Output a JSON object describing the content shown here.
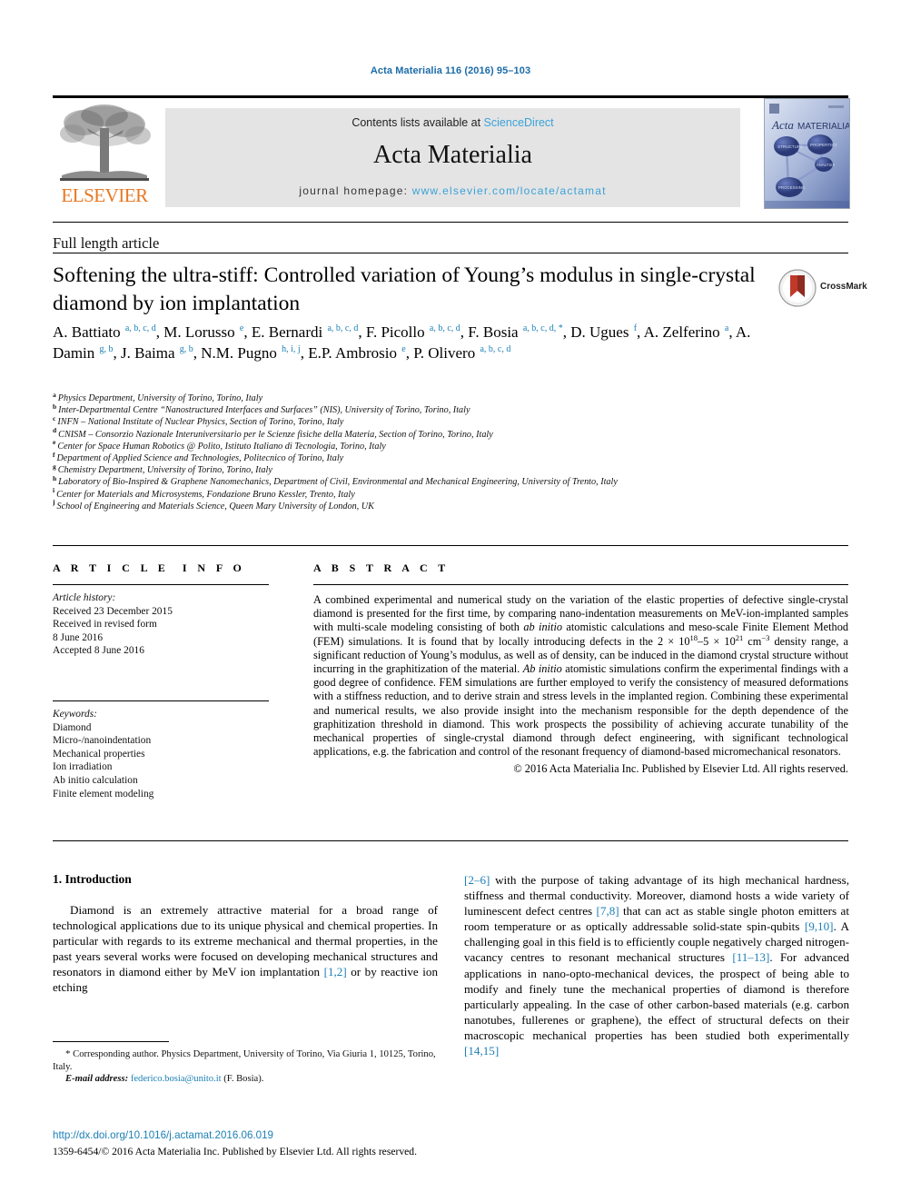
{
  "running_head": "Acta Materialia 116 (2016) 95–103",
  "banner": {
    "publisher_name": "ELSEVIER",
    "contents_prefix": "Contents lists available at ",
    "contents_link": "ScienceDirect",
    "journal_title": "Acta Materialia",
    "homepage_prefix": "journal homepage: ",
    "homepage_url": "www.elsevier.com/locate/actamat",
    "cover_title_italic": "Acta",
    "cover_title_rest": "MATERIALIA",
    "cover_nodes": [
      "STRUCTURE",
      "PROPERTIES",
      "ANALYSIS",
      "PROCESSING"
    ]
  },
  "article": {
    "type": "Full length article",
    "title": "Softening the ultra-stiff: Controlled variation of Young’s modulus in single-crystal diamond by ion implantation",
    "crossmark_label": "CrossMark"
  },
  "authors": [
    {
      "name": "A. Battiato",
      "marks": "a, b, c, d",
      "sep": ", "
    },
    {
      "name": "M. Lorusso",
      "marks": "e",
      "sep": ", "
    },
    {
      "name": "E. Bernardi",
      "marks": "a, b, c, d",
      "sep": ", "
    },
    {
      "name": "F. Picollo",
      "marks": "a, b, c, d",
      "sep": ", "
    },
    {
      "name": "F. Bosia",
      "marks": "a, b, c, d, *",
      "sep": ", "
    },
    {
      "name": "D. Ugues",
      "marks": "f",
      "sep": ", "
    },
    {
      "name": "A. Zelferino",
      "marks": "a",
      "sep": ", "
    },
    {
      "name": "A. Damin",
      "marks": "g, b",
      "sep": ", "
    },
    {
      "name": "J. Baima",
      "marks": "g, b",
      "sep": ", "
    },
    {
      "name": "N.M. Pugno",
      "marks": "h, i, j",
      "sep": ", "
    },
    {
      "name": "E.P. Ambrosio",
      "marks": "e",
      "sep": ", "
    },
    {
      "name": "P. Olivero",
      "marks": "a, b, c, d",
      "sep": ""
    }
  ],
  "affiliations": [
    {
      "mark": "a",
      "text": "Physics Department, University of Torino, Torino, Italy"
    },
    {
      "mark": "b",
      "text": "Inter-Departmental Centre “Nanostructured Interfaces and Surfaces” (NIS), University of Torino, Torino, Italy"
    },
    {
      "mark": "c",
      "text": "INFN – National Institute of Nuclear Physics, Section of Torino, Torino, Italy"
    },
    {
      "mark": "d",
      "text": "CNISM – Consorzio Nazionale Interuniversitario per le Scienze fisiche della Materia, Section of Torino, Torino, Italy"
    },
    {
      "mark": "e",
      "text": "Center for Space Human Robotics @ Polito, Istituto Italiano di Tecnologia, Torino, Italy"
    },
    {
      "mark": "f",
      "text": "Department of Applied Science and Technologies, Politecnico of Torino, Italy"
    },
    {
      "mark": "g",
      "text": "Chemistry Department, University of Torino, Torino, Italy"
    },
    {
      "mark": "h",
      "text": "Laboratory of Bio-Inspired & Graphene Nanomechanics, Department of Civil, Environmental and Mechanical Engineering, University of Trento, Italy"
    },
    {
      "mark": "i",
      "text": "Center for Materials and Microsystems, Fondazione Bruno Kessler, Trento, Italy"
    },
    {
      "mark": "j",
      "text": "School of Engineering and Materials Science, Queen Mary University of London, UK"
    }
  ],
  "article_info": {
    "heading": "ARTICLE INFO",
    "history_label": "Article history:",
    "history": [
      "Received 23 December 2015",
      "Received in revised form",
      "8 June 2016",
      "Accepted 8 June 2016"
    ],
    "keywords_label": "Keywords:",
    "keywords": [
      "Diamond",
      "Micro-/nanoindentation",
      "Mechanical properties",
      "Ion irradiation",
      "Ab initio calculation",
      "Finite element modeling"
    ]
  },
  "abstract": {
    "heading": "ABSTRACT",
    "p1_a": "A combined experimental and numerical study on the variation of the elastic properties of defective single-crystal diamond is presented for the first time, by comparing nano-indentation measurements on MeV-ion-implanted samples with multi-scale modeling consisting of both ",
    "p1_ab1": "ab initio",
    "p1_b": " atomistic calculations and meso-scale Finite Element Method (FEM) simulations. It is found that by locally introducing defects in the 2 × 10",
    "exp1": "18",
    "p1_c": "–5 × 10",
    "exp2": "21",
    "p1_d": " cm",
    "exp3": "−3",
    "p1_e": " density range, a significant reduction of Young’s modulus, as well as of density, can be induced in the diamond crystal structure without incurring in the graphitization of the material. ",
    "p1_ab2": "Ab initio",
    "p1_f": " atomistic simulations confirm the experimental findings with a good degree of confidence. FEM simulations are further employed to verify the consistency of measured deformations with a stiffness reduction, and to derive strain and stress levels in the implanted region. Combining these experimental and numerical results, we also provide insight into the mechanism responsible for the depth dependence of the graphitization threshold in diamond. This work prospects the possibility of achieving accurate tunability of the mechanical properties of single-crystal diamond through defect engineering, with significant technological applications, e.g. the fabrication and control of the resonant frequency of diamond-based micromechanical resonators.",
    "copyright": "© 2016 Acta Materialia Inc. Published by Elsevier Ltd. All rights reserved."
  },
  "body": {
    "section_number_title": "1. Introduction",
    "left_p1_a": "Diamond is an extremely attractive material for a broad range of technological applications due to its unique physical and chemical properties. In particular with regards to its extreme mechanical and thermal properties, in the past years several works were focused on developing mechanical structures and resonators in diamond either by MeV ion implantation ",
    "left_ref1": "[1,2]",
    "left_p1_b": " or by reactive ion etching",
    "right_ref1": "[2–6]",
    "right_a": " with the purpose of taking advantage of its high mechanical hardness, stiffness and thermal conductivity. Moreover, diamond hosts a wide variety of luminescent defect centres ",
    "right_ref2": "[7,8]",
    "right_b": " that can act as stable single photon emitters at room temperature or as optically addressable solid-state spin-qubits ",
    "right_ref3": "[9,10]",
    "right_c": ". A challenging goal in this field is to efficiently couple negatively charged nitrogen-vacancy centres to resonant mechanical structures ",
    "right_ref4": "[11–13]",
    "right_d": ". For advanced applications in nano-opto-mechanical devices, the prospect of being able to modify and finely tune the mechanical properties of diamond is therefore particularly appealing. In the case of other carbon-based materials (e.g. carbon nanotubes, fullerenes or graphene), the effect of structural defects on their macroscopic mechanical properties has been studied both experimentally ",
    "right_ref5": "[14,15]"
  },
  "footnote": {
    "star": "*",
    "corresponding": " Corresponding author. Physics Department, University of Torino, Via Giuria 1, 10125, Torino, Italy.",
    "email_label": "E-mail address:",
    "email": "federico.bosia@unito.it",
    "email_suffix": " (F. Bosia)."
  },
  "footer": {
    "doi": "http://dx.doi.org/10.1016/j.actamat.2016.06.019",
    "issn_line": "1359-6454/© 2016 Acta Materialia Inc. Published by Elsevier Ltd. All rights reserved."
  },
  "colors": {
    "link": "#1b7fb5",
    "sciencedirect": "#3aa2d8",
    "elsevier_orange": "#e87722",
    "banner_bg": "#e4e4e4"
  }
}
